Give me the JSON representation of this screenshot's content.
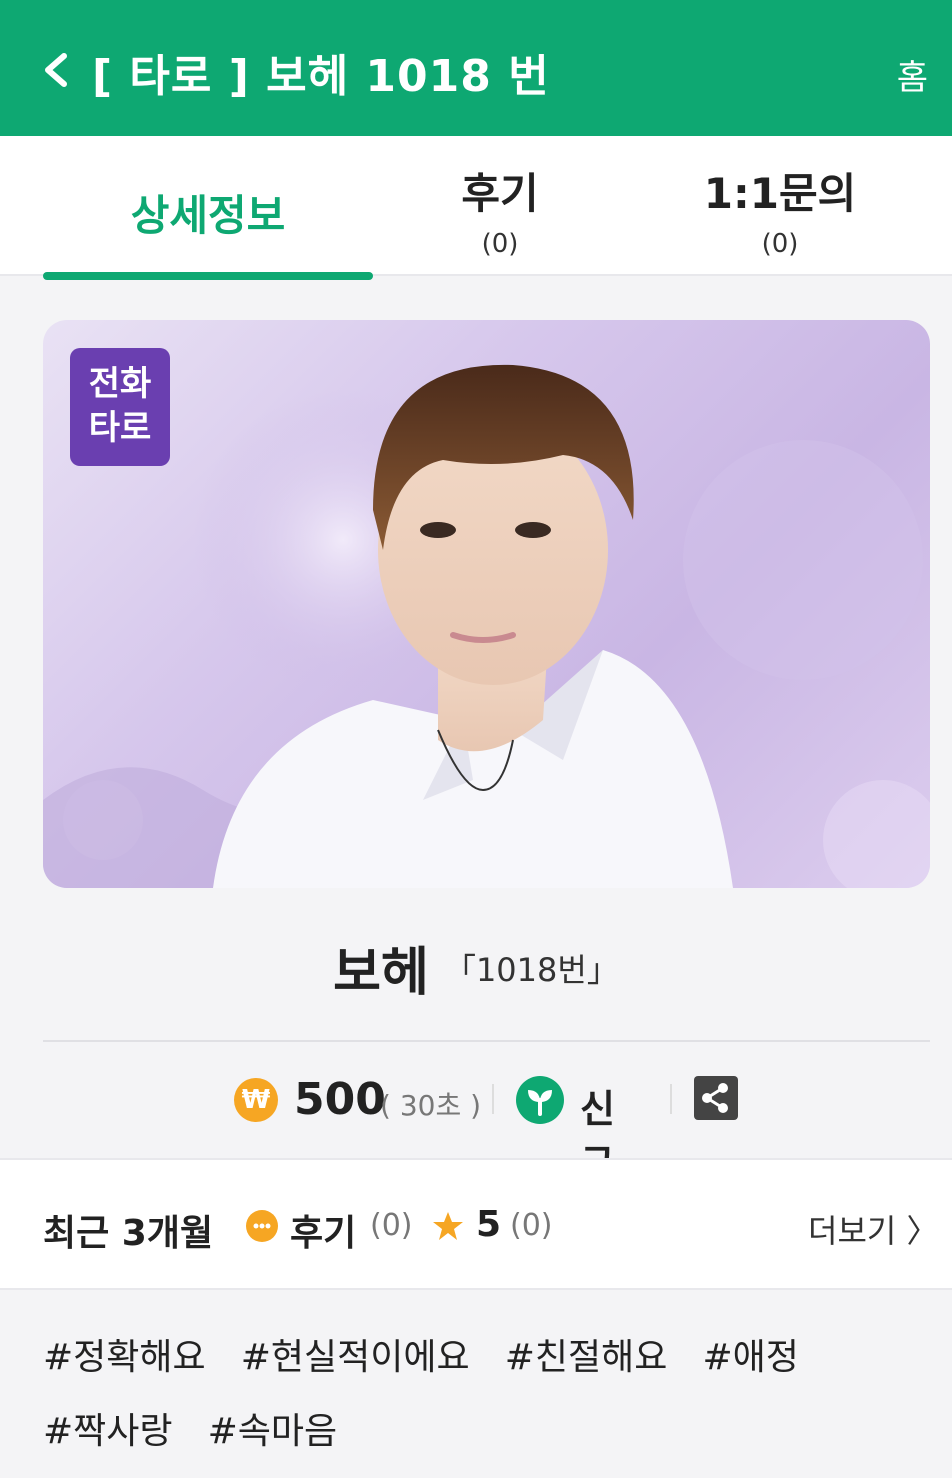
{
  "header": {
    "title": "[ 타로 ] 보헤 1018 번",
    "home_label": "홈"
  },
  "tabs": [
    {
      "label": "상세정보",
      "count": ""
    },
    {
      "label": "후기",
      "count": "(0)"
    },
    {
      "label": "1:1문의",
      "count": "(0)"
    }
  ],
  "banner": {
    "badge_line1": "전화",
    "badge_line2": "타로"
  },
  "profile": {
    "name": "보헤",
    "number": "「1018번」"
  },
  "info": {
    "currency_symbol": "₩",
    "price": "500",
    "per_unit": "( 30초 )",
    "status": "신규"
  },
  "reviews": {
    "period_label": "최근 3개월",
    "review_label": "후기",
    "review_count": "(0)",
    "rating": "5",
    "rating_count": "(0)",
    "more_label": "더보기 〉"
  },
  "tags": [
    "#정확해요",
    "#현실적이에요",
    "#친절해요",
    "#애정",
    "#짝사랑",
    "#속마음"
  ],
  "colors": {
    "brand": "#0ea872",
    "badge": "#6a3fb0",
    "accent": "#f6a623"
  }
}
